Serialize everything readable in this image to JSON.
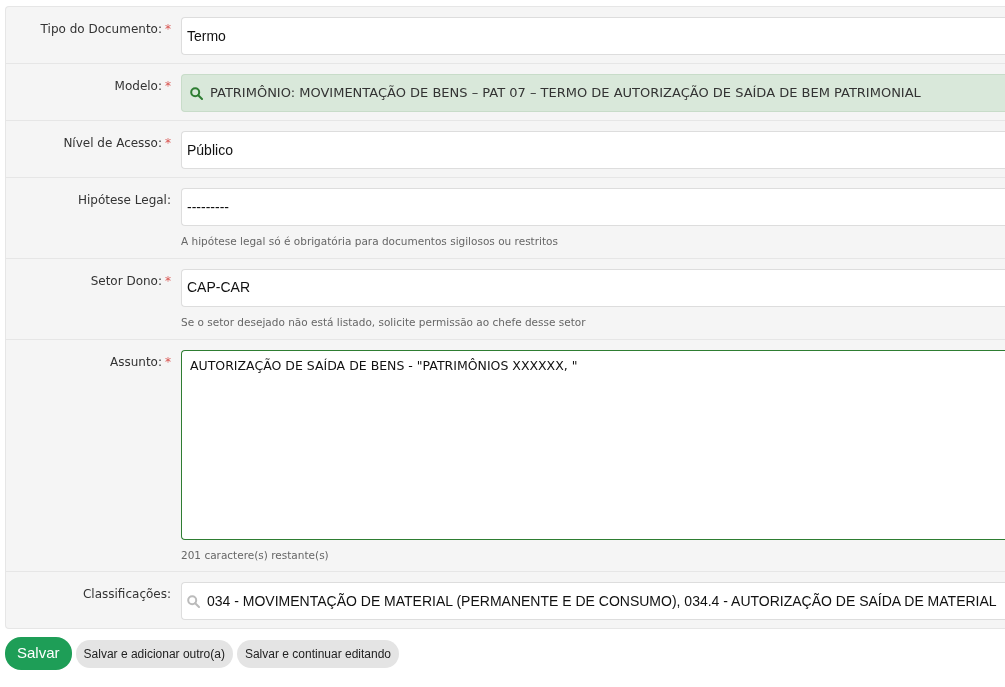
{
  "fields": [
    {
      "kind": "select",
      "label": "Tipo do Documento:",
      "required_mark": "*",
      "value": "Termo"
    },
    {
      "kind": "lookup_selected",
      "label": "Modelo:",
      "required_mark": "*",
      "value": "PATRIMÔNIO: MOVIMENTAÇÃO DE BENS – PAT 07 – TERMO DE AUTORIZAÇÃO DE SAÍDA DE BEM PATRIMONIAL"
    },
    {
      "kind": "select",
      "label": "Nível de Acesso:",
      "required_mark": "*",
      "value": "Público"
    },
    {
      "kind": "select",
      "label": "Hipótese Legal:",
      "value": "---------",
      "help": "A hipótese legal só é obrigatória para documentos sigilosos ou restritos"
    },
    {
      "kind": "select",
      "label": "Setor Dono:",
      "required_mark": "*",
      "value": "CAP-CAR",
      "help": "Se o setor desejado não está listado, solicite permissão ao chefe desse setor"
    },
    {
      "kind": "textarea",
      "label": "Assunto:",
      "required_mark": "*",
      "value": "AUTORIZAÇÃO DE SAÍDA DE BENS - \"PATRIMÔNIOS XXXXXX, \"",
      "focused": true,
      "help": "201 caractere(s) restante(s)"
    },
    {
      "kind": "lookup",
      "label": "Classificações:",
      "value": "034 - MOVIMENTAÇÃO DE MATERIAL (PERMANENTE E DE CONSUMO), 034.4 - AUTORIZAÇÃO DE SAÍDA DE MATERIAL"
    }
  ],
  "buttons": [
    {
      "label": "Salvar",
      "primary": true
    },
    {
      "label": "Salvar e adicionar outro(a)",
      "primary": false
    },
    {
      "label": "Salvar e continuar editando",
      "primary": false
    }
  ]
}
